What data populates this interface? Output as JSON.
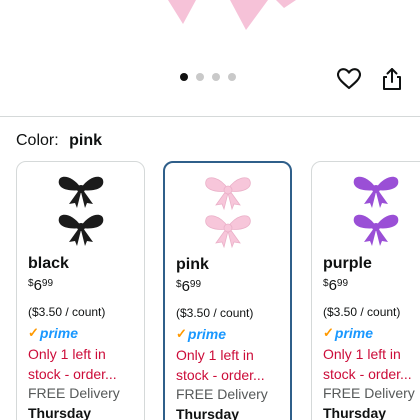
{
  "gallery": {
    "dot_count": 4,
    "active_dot": 0
  },
  "icons": {
    "favorite": "heart-icon",
    "share": "share-icon"
  },
  "color_selector": {
    "label": "Color:",
    "selected": "pink"
  },
  "swatches": [
    {
      "name": "black",
      "currency": "$",
      "price_whole": "6",
      "price_cents": "99",
      "unit_price": "($3.50 / count)",
      "prime_label": "prime",
      "stock": "Only 1 left in stock - order...",
      "delivery": "FREE Delivery",
      "day": "Thursday",
      "bow_color": "#1b1b1b",
      "selected": false
    },
    {
      "name": "pink",
      "currency": "$",
      "price_whole": "6",
      "price_cents": "99",
      "unit_price": "($3.50 / count)",
      "prime_label": "prime",
      "stock": "Only 1 left in stock - order...",
      "delivery": "FREE Delivery",
      "day": "Thursday",
      "bow_color": "#f7c6da",
      "selected": true
    },
    {
      "name": "purple",
      "currency": "$",
      "price_whole": "6",
      "price_cents": "99",
      "unit_price": "($3.50 / count)",
      "prime_label": "prime",
      "stock": "Only 1 left in stock - order...",
      "delivery": "FREE Delivery",
      "day": "Thursday",
      "bow_color": "#9a4fd6",
      "selected": false
    }
  ],
  "colors": {
    "selected_border": "#2f5f8a",
    "stock_red": "#cc0c39",
    "prime_blue": "#1a98ff",
    "prime_check": "#ff9900"
  }
}
